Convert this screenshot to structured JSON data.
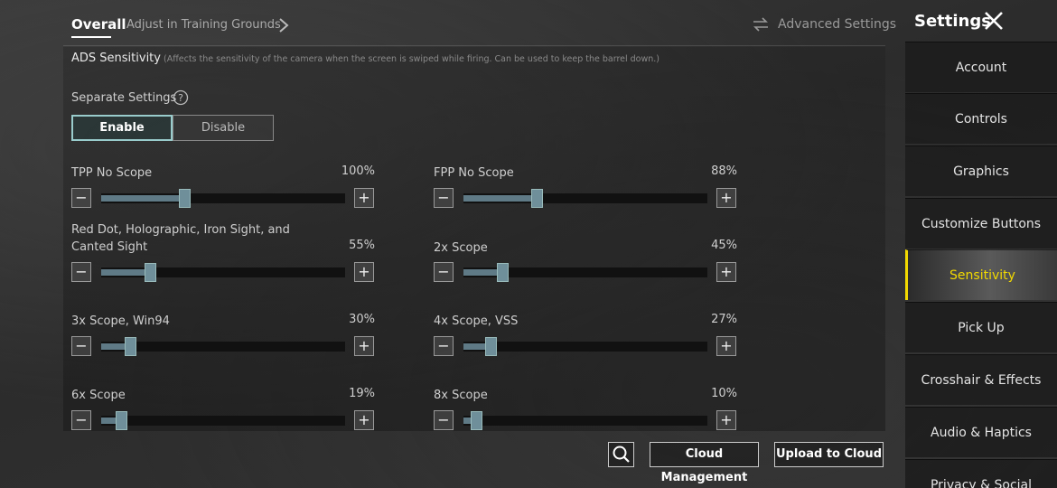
{
  "header": {
    "tab_overall": "Overall",
    "tab_training": "Adjust in Training Grounds",
    "advanced_settings": "Advanced Settings",
    "settings_title": "Settings"
  },
  "ads": {
    "title": "ADS Sensitivity",
    "description": "(Affects the sensitivity of the camera when the screen is swiped while firing. Can be used to keep the barrel down.)"
  },
  "separate": {
    "label": "Separate Settings",
    "enable": "Enable",
    "disable": "Disable",
    "selected": "Enable"
  },
  "sliders": [
    {
      "label": "TPP No Scope",
      "value": "100%",
      "level": 0.34
    },
    {
      "label": "FPP No Scope",
      "value": "88%",
      "level": 0.3
    },
    {
      "label": "Red Dot, Holographic, Iron Sight, and Canted Sight",
      "value": "55%",
      "level": 0.2
    },
    {
      "label": "2x Scope",
      "value": "45%",
      "level": 0.16
    },
    {
      "label": "3x Scope, Win94",
      "value": "30%",
      "level": 0.12
    },
    {
      "label": "4x Scope, VSS",
      "value": "27%",
      "level": 0.11
    },
    {
      "label": "6x Scope",
      "value": "19%",
      "level": 0.08
    },
    {
      "label": "8x Scope",
      "value": "10%",
      "level": 0.05
    }
  ],
  "bottom": {
    "cloud_management": "Cloud Management",
    "upload_to_cloud": "Upload to Cloud"
  },
  "sidebar": {
    "items": [
      {
        "label": "Account"
      },
      {
        "label": "Controls"
      },
      {
        "label": "Graphics"
      },
      {
        "label": "Customize Buttons"
      },
      {
        "label": "Sensitivity",
        "active": true
      },
      {
        "label": "Pick Up"
      },
      {
        "label": "Crosshair & Effects"
      },
      {
        "label": "Audio & Haptics"
      },
      {
        "label": "Privacy & Social"
      }
    ]
  },
  "colors": {
    "accent": "#f2d900",
    "slider_fill": "#5f7a86"
  }
}
